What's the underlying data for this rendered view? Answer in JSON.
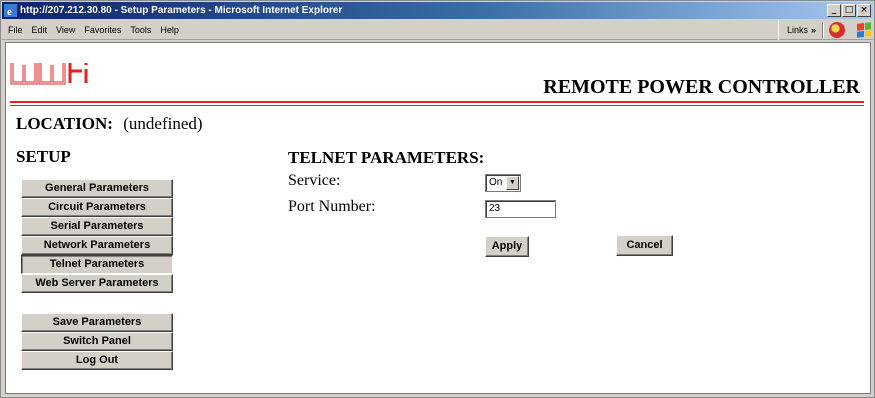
{
  "window": {
    "title": "http://207.212.30.80 - Setup Parameters - Microsoft Internet Explorer",
    "controls": [
      "_",
      "□",
      "×"
    ]
  },
  "menubar": {
    "items": [
      "File",
      "Edit",
      "View",
      "Favorites",
      "Tools",
      "Help"
    ],
    "links_label": "Links",
    "links_chevron": "»"
  },
  "header": {
    "logo_text": "wti",
    "title": "REMOTE POWER CONTROLLER",
    "rule_color": "#e32222"
  },
  "location": {
    "label": "LOCATION:",
    "value": "(undefined)"
  },
  "setup": {
    "title": "SETUP",
    "nav_primary": [
      "General Parameters",
      "Circuit Parameters",
      "Serial Parameters",
      "Network Parameters",
      "Telnet Parameters",
      "Web Server Parameters"
    ],
    "active_item": "Telnet Parameters",
    "nav_secondary": [
      "Save Parameters",
      "Switch Panel",
      "Log Out"
    ]
  },
  "telnet": {
    "title": "TELNET PARAMETERS:",
    "service_label": "Service:",
    "service_value": "On",
    "port_label": "Port Number:",
    "port_value": "23",
    "apply_label": "Apply",
    "cancel_label": "Cancel"
  }
}
